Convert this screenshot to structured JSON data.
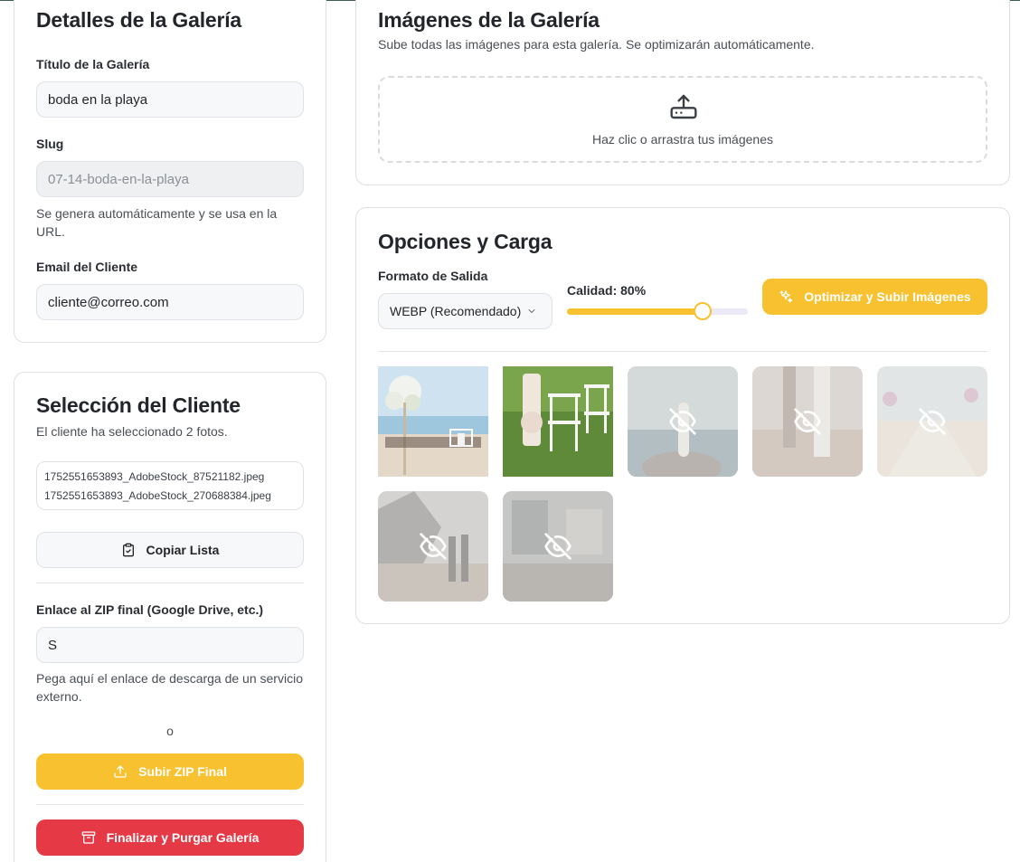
{
  "details": {
    "title": "Detalles de la Galería",
    "gallery_title_label": "Título de la Galería",
    "gallery_title_value": "boda en la playa",
    "slug_label": "Slug",
    "slug_value": "07-14-boda-en-la-playa",
    "slug_help": "Se genera automáticamente y se usa en la URL.",
    "email_label": "Email del Cliente",
    "email_value": "cliente@correo.com"
  },
  "selection": {
    "title": "Selección del Cliente",
    "subtitle": "El cliente ha seleccionado 2 fotos.",
    "files": [
      "1752551653893_AdobeStock_87521182.jpeg",
      "1752551653893_AdobeStock_270688384.jpeg"
    ],
    "copy_label": "Copiar Lista",
    "zip_label": "Enlace al ZIP final (Google Drive, etc.)",
    "zip_value": "S",
    "zip_help": "Pega aquí el enlace de descarga de un servicio externo.",
    "or_text": "o",
    "upload_zip_label": "Subir ZIP Final",
    "finalize_label": "Finalizar y Purgar Galería"
  },
  "images": {
    "title": "Imágenes de la Galería",
    "subtitle": "Sube todas las imágenes para esta galería. Se optimizarán automáticamente.",
    "dropzone_text": "Haz clic o arrastra tus imágenes"
  },
  "options": {
    "title": "Opciones y Carga",
    "format_label": "Formato de Salida",
    "format_value": "WEBP (Recomendado)",
    "quality_label": "Calidad: 80%",
    "quality_value": 80,
    "optimize_label": "Optimizar y Subir Imágenes",
    "thumbnails": [
      {
        "visible": true,
        "icon": "photo"
      },
      {
        "visible": true,
        "icon": "photo"
      },
      {
        "visible": false,
        "icon": "eye-off-icon"
      },
      {
        "visible": false,
        "icon": "eye-off-icon"
      },
      {
        "visible": false,
        "icon": "eye-off-icon"
      },
      {
        "visible": false,
        "icon": "eye-off-icon"
      },
      {
        "visible": false,
        "icon": "eye-off-icon"
      }
    ]
  },
  "colors": {
    "accent_yellow": "#f7c12f",
    "danger_red": "#e63946"
  }
}
